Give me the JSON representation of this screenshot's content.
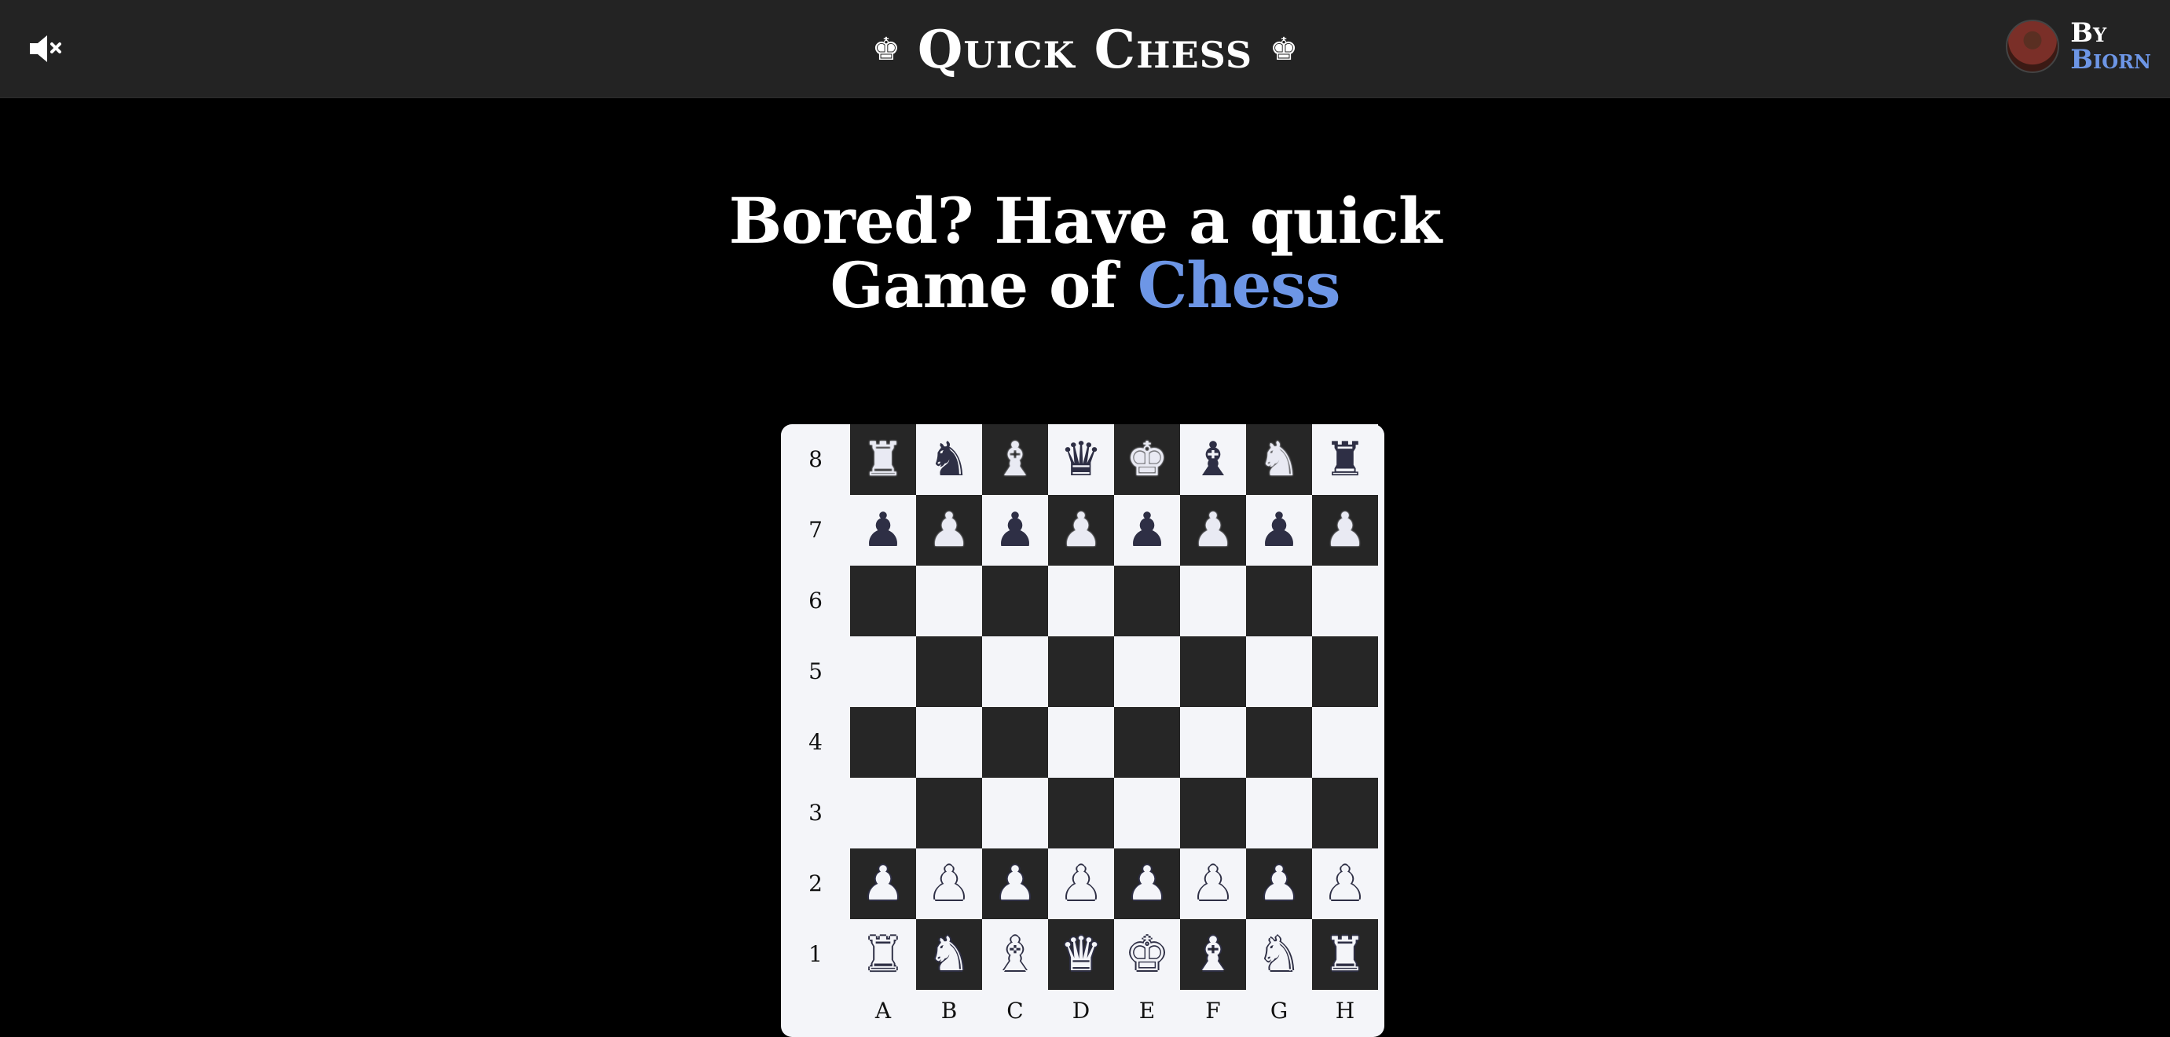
{
  "header": {
    "title": "Quick Chess",
    "crown_left": "♚",
    "crown_right": "♚",
    "mute_icon": "speaker-muted-icon",
    "author_by": "By",
    "author_name": "Biorn"
  },
  "heading": {
    "line1": "Bored? Have a quick",
    "line2_prefix": "Game of ",
    "line2_accent": "Chess"
  },
  "colors": {
    "background": "#000000",
    "topbar": "#232323",
    "accent": "#6d96e6",
    "dark_square": "#262626",
    "light_square": "#f4f5f9",
    "piece_ink": "#2e2f45"
  },
  "board": {
    "ranks": [
      "8",
      "7",
      "6",
      "5",
      "4",
      "3",
      "2",
      "1"
    ],
    "files": [
      "A",
      "B",
      "C",
      "D",
      "E",
      "F",
      "G",
      "H"
    ],
    "pieces": [
      [
        "bR",
        "bN",
        "bB",
        "bQ",
        "bK",
        "bB",
        "bN",
        "bR"
      ],
      [
        "bP",
        "bP",
        "bP",
        "bP",
        "bP",
        "bP",
        "bP",
        "bP"
      ],
      [
        "",
        "",
        "",
        "",
        "",
        "",
        "",
        ""
      ],
      [
        "",
        "",
        "",
        "",
        "",
        "",
        "",
        ""
      ],
      [
        "",
        "",
        "",
        "",
        "",
        "",
        "",
        ""
      ],
      [
        "",
        "",
        "",
        "",
        "",
        "",
        "",
        ""
      ],
      [
        "wP",
        "wP",
        "wP",
        "wP",
        "wP",
        "wP",
        "wP",
        "wP"
      ],
      [
        "wR",
        "wN",
        "wB",
        "wQ",
        "wK",
        "wB",
        "wN",
        "wR"
      ]
    ]
  }
}
